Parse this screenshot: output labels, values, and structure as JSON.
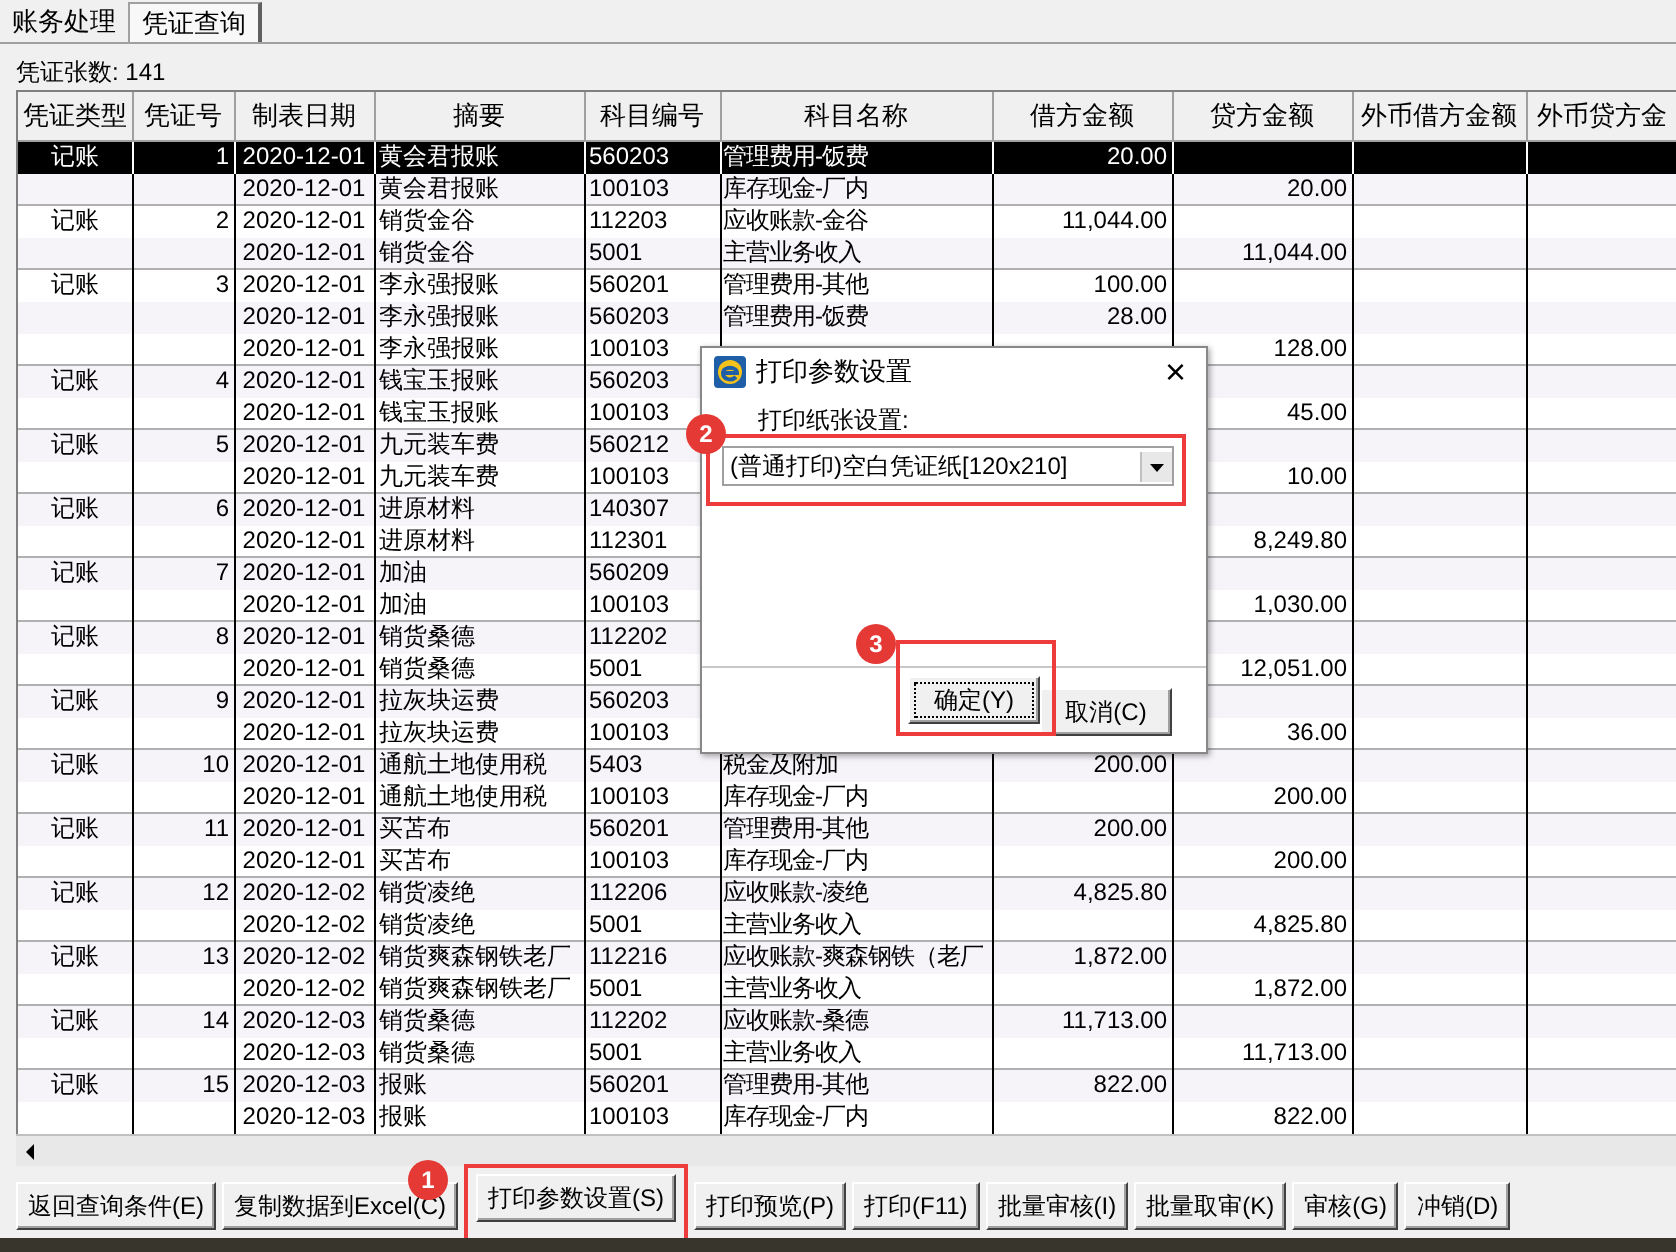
{
  "tabs": [
    {
      "label": "账务处理",
      "selected": false
    },
    {
      "label": "凭证查询",
      "selected": true
    }
  ],
  "count_label": "凭证张数: 141",
  "table": {
    "columns": [
      "凭证类型",
      "凭证号",
      "制表日期",
      "摘要",
      "科目编号",
      "科目名称",
      "借方金额",
      "贷方金额",
      "外币借方金额",
      "外币贷方金"
    ],
    "rows": [
      {
        "type": "记账",
        "no": "1",
        "date": "2020-12-01",
        "summary": "黄会君报账",
        "code": "560203",
        "account": "管理费用-饭费",
        "debit": "20.00",
        "selected": true
      },
      {
        "date": "2020-12-01",
        "summary": "黄会君报账",
        "code": "100103",
        "account": "库存现金-厂内",
        "credit": "20.00",
        "selected": false
      },
      {
        "type": "记账",
        "no": "2",
        "date": "2020-12-01",
        "summary": "销货金谷",
        "code": "112203",
        "account": "应收账款-金谷",
        "debit": "11,044.00",
        "selected": false
      },
      {
        "date": "2020-12-01",
        "summary": "销货金谷",
        "code": "5001",
        "account": "主营业务收入",
        "credit": "11,044.00",
        "selected": false
      },
      {
        "type": "记账",
        "no": "3",
        "date": "2020-12-01",
        "summary": "李永强报账",
        "code": "560201",
        "account": "管理费用-其他",
        "debit": "100.00",
        "selected": false
      },
      {
        "date": "2020-12-01",
        "summary": "李永强报账",
        "code": "560203",
        "account": "管理费用-饭费",
        "debit": "28.00",
        "selected": false
      },
      {
        "date": "2020-12-01",
        "summary": "李永强报账",
        "code": "100103",
        "credit": "128.00",
        "selected": false
      },
      {
        "type": "记账",
        "no": "4",
        "date": "2020-12-01",
        "summary": "钱宝玉报账",
        "code": "560203",
        "selected": false
      },
      {
        "date": "2020-12-01",
        "summary": "钱宝玉报账",
        "code": "100103",
        "credit": "45.00",
        "selected": false
      },
      {
        "type": "记账",
        "no": "5",
        "date": "2020-12-01",
        "summary": "九元装车费",
        "code": "560212",
        "selected": false
      },
      {
        "date": "2020-12-01",
        "summary": "九元装车费",
        "code": "100103",
        "credit": "10.00",
        "selected": false
      },
      {
        "type": "记账",
        "no": "6",
        "date": "2020-12-01",
        "summary": "进原材料",
        "code": "140307",
        "selected": false
      },
      {
        "date": "2020-12-01",
        "summary": "进原材料",
        "code": "112301",
        "credit": "8,249.80",
        "selected": false
      },
      {
        "type": "记账",
        "no": "7",
        "date": "2020-12-01",
        "summary": "加油",
        "code": "560209",
        "selected": false
      },
      {
        "date": "2020-12-01",
        "summary": "加油",
        "code": "100103",
        "credit": "1,030.00",
        "selected": false
      },
      {
        "type": "记账",
        "no": "8",
        "date": "2020-12-01",
        "summary": "销货桑德",
        "code": "112202",
        "selected": false
      },
      {
        "date": "2020-12-01",
        "summary": "销货桑德",
        "code": "5001",
        "credit": "12,051.00",
        "selected": false
      },
      {
        "type": "记账",
        "no": "9",
        "date": "2020-12-01",
        "summary": "拉灰块运费",
        "code": "560203",
        "selected": false
      },
      {
        "date": "2020-12-01",
        "summary": "拉灰块运费",
        "code": "100103",
        "credit": "36.00",
        "selected": false
      },
      {
        "type": "记账",
        "no": "10",
        "date": "2020-12-01",
        "summary": "通航土地使用税",
        "code": "5403",
        "account": "税金及附加",
        "debit": "200.00",
        "selected": false
      },
      {
        "date": "2020-12-01",
        "summary": "通航土地使用税",
        "code": "100103",
        "account": "库存现金-厂内",
        "credit": "200.00",
        "selected": false
      },
      {
        "type": "记账",
        "no": "11",
        "date": "2020-12-01",
        "summary": "买苫布",
        "code": "560201",
        "account": "管理费用-其他",
        "debit": "200.00",
        "selected": false
      },
      {
        "date": "2020-12-01",
        "summary": "买苫布",
        "code": "100103",
        "account": "库存现金-厂内",
        "credit": "200.00",
        "selected": false
      },
      {
        "type": "记账",
        "no": "12",
        "date": "2020-12-02",
        "summary": "销货凌绝",
        "code": "112206",
        "account": "应收账款-凌绝",
        "debit": "4,825.80",
        "selected": false
      },
      {
        "date": "2020-12-02",
        "summary": "销货凌绝",
        "code": "5001",
        "account": "主营业务收入",
        "credit": "4,825.80",
        "selected": false
      },
      {
        "type": "记账",
        "no": "13",
        "date": "2020-12-02",
        "summary": "销货爽森钢铁老厂",
        "code": "112216",
        "account": "应收账款-爽森钢铁（老厂",
        "debit": "1,872.00",
        "selected": false
      },
      {
        "date": "2020-12-02",
        "summary": "销货爽森钢铁老厂",
        "code": "5001",
        "account": "主营业务收入",
        "credit": "1,872.00",
        "selected": false
      },
      {
        "type": "记账",
        "no": "14",
        "date": "2020-12-03",
        "summary": "销货桑德",
        "code": "112202",
        "account": "应收账款-桑德",
        "debit": "11,713.00",
        "selected": false
      },
      {
        "date": "2020-12-03",
        "summary": "销货桑德",
        "code": "5001",
        "account": "主营业务收入",
        "credit": "11,713.00",
        "selected": false
      },
      {
        "type": "记账",
        "no": "15",
        "date": "2020-12-03",
        "summary": "报账",
        "code": "560201",
        "account": "管理费用-其他",
        "debit": "822.00",
        "selected": false
      },
      {
        "date": "2020-12-03",
        "summary": "报账",
        "code": "100103",
        "account": "库存现金-厂内",
        "credit": "822.00",
        "selected": false
      }
    ]
  },
  "buttons": [
    {
      "label": "返回查询条件(E)"
    },
    {
      "label": "复制数据到Excel(C)"
    },
    {
      "label": "打印参数设置(S)",
      "step": "1"
    },
    {
      "label": "打印预览(P)"
    },
    {
      "label": "打印(F11)"
    },
    {
      "label": "批量审核(I)"
    },
    {
      "label": "批量取审(K)"
    },
    {
      "label": "审核(G)"
    },
    {
      "label": "冲销(D)"
    }
  ],
  "dialog": {
    "title": "打印参数设置",
    "close": "×",
    "field_label": "打印纸张设置:",
    "paper": "(普通打印)空白凭证纸[120x210]",
    "paper_step": "2",
    "buttons": [
      {
        "label": "确定(Y)",
        "focused": true,
        "step": "3"
      },
      {
        "label": "取消(C)",
        "focused": false
      }
    ]
  }
}
